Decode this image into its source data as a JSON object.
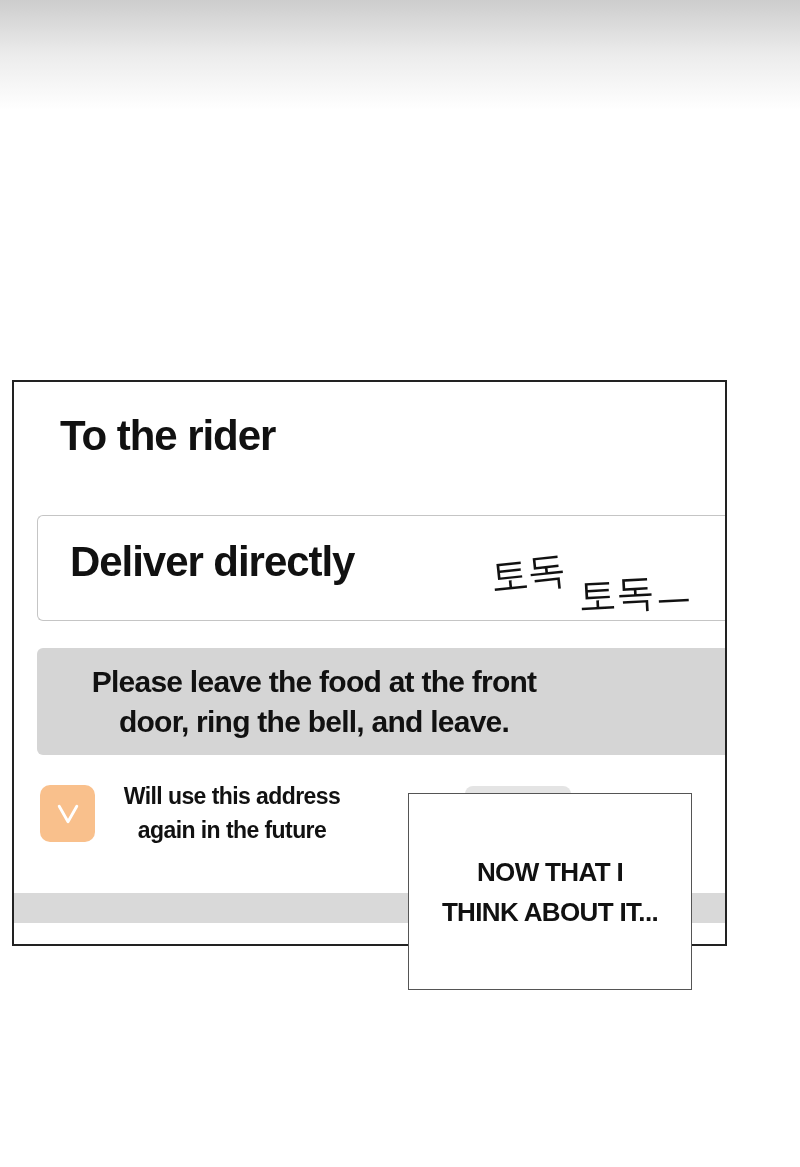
{
  "panel": {
    "title": "To the rider",
    "delivery_field": {
      "value": "Deliver directly"
    },
    "sound_effects": [
      "토독",
      "토독ㅡ"
    ],
    "note": "Please leave the food at the front door, ring the bell, and leave.",
    "save_address": {
      "label": "Will use this address again in the future",
      "checked": true
    }
  },
  "caption": "NOW THAT I\nTHINK ABOUT IT..."
}
